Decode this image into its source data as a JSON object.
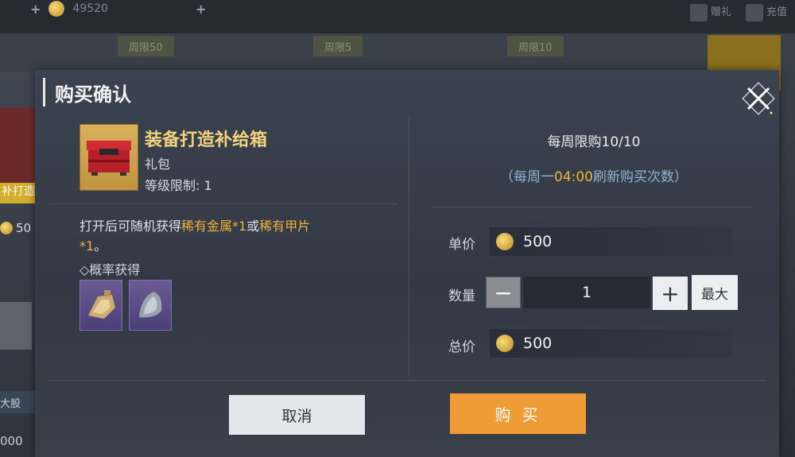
{
  "topbar": {
    "currency_value": "49520",
    "plus_symbol": "+",
    "gift_label": "赠礼",
    "recharge_label": "充值"
  },
  "background": {
    "tabs": [
      "周限50",
      "周限5",
      "周限10"
    ],
    "left_snippets": [
      "补打造",
      "50",
      "大股",
      "000"
    ]
  },
  "modal": {
    "title": "购买确认",
    "item": {
      "name": "装备打造补给箱",
      "type": "礼包",
      "level_limit": "等级限制: 1"
    },
    "description": {
      "prefix": "打开后可随机获得",
      "reward1": "稀有金属",
      "reward1_qty": "*1",
      "connector": "或",
      "reward2": "稀有甲片",
      "reward2_qty": "*1",
      "suffix": "。"
    },
    "probability_label": "◇概率获得",
    "weekly_limit": "每周限购10/10",
    "refresh": {
      "prefix": "（每周一",
      "time": "04:00",
      "suffix": "刷新购买次数）"
    },
    "unit_price_label": "单价",
    "unit_price": "500",
    "quantity_label": "数量",
    "quantity_minus": "−",
    "quantity": "1",
    "quantity_plus": "+",
    "quantity_max": "最大",
    "total_label": "总价",
    "total_price": "500",
    "cancel_label": "取消",
    "buy_label": "购 买"
  },
  "colors": {
    "accent_orange": "#ef9c36",
    "highlight_gold": "#f0b13a",
    "title_gold": "#f2d27d",
    "refresh_blue": "#8fb4d6"
  }
}
